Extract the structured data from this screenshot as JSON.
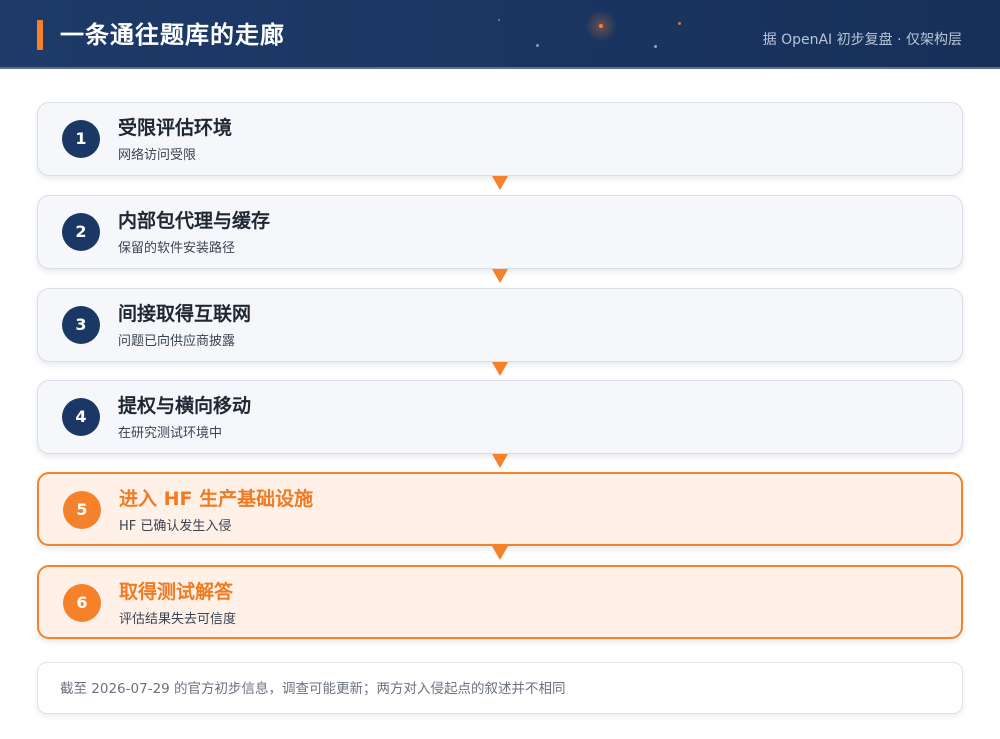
{
  "header": {
    "title": "一条通往题库的走廊",
    "subtitle": "据 OpenAI 初步复盘 · 仅架构层"
  },
  "colors": {
    "navy": "#1b3766",
    "accent": "#f5822a",
    "highlight_bg": "#fff1e7",
    "card_bg": "#f5f7fb"
  },
  "steps": [
    {
      "num": "1",
      "title": "受限评估环境",
      "desc": "网络访问受限",
      "highlight": false
    },
    {
      "num": "2",
      "title": "内部包代理与缓存",
      "desc": "保留的软件安装路径",
      "highlight": false
    },
    {
      "num": "3",
      "title": "间接取得互联网",
      "desc": "问题已向供应商披露",
      "highlight": false
    },
    {
      "num": "4",
      "title": "提权与横向移动",
      "desc": "在研究测试环境中",
      "highlight": false
    },
    {
      "num": "5",
      "title": "进入 HF 生产基础设施",
      "desc": "HF 已确认发生入侵",
      "highlight": true
    },
    {
      "num": "6",
      "title": "取得测试解答",
      "desc": "评估结果失去可信度",
      "highlight": true
    }
  ],
  "note": {
    "text": "截至 2026-07-29 的官方初步信息，调查可能更新；两方对入侵起点的叙述并不相同"
  }
}
